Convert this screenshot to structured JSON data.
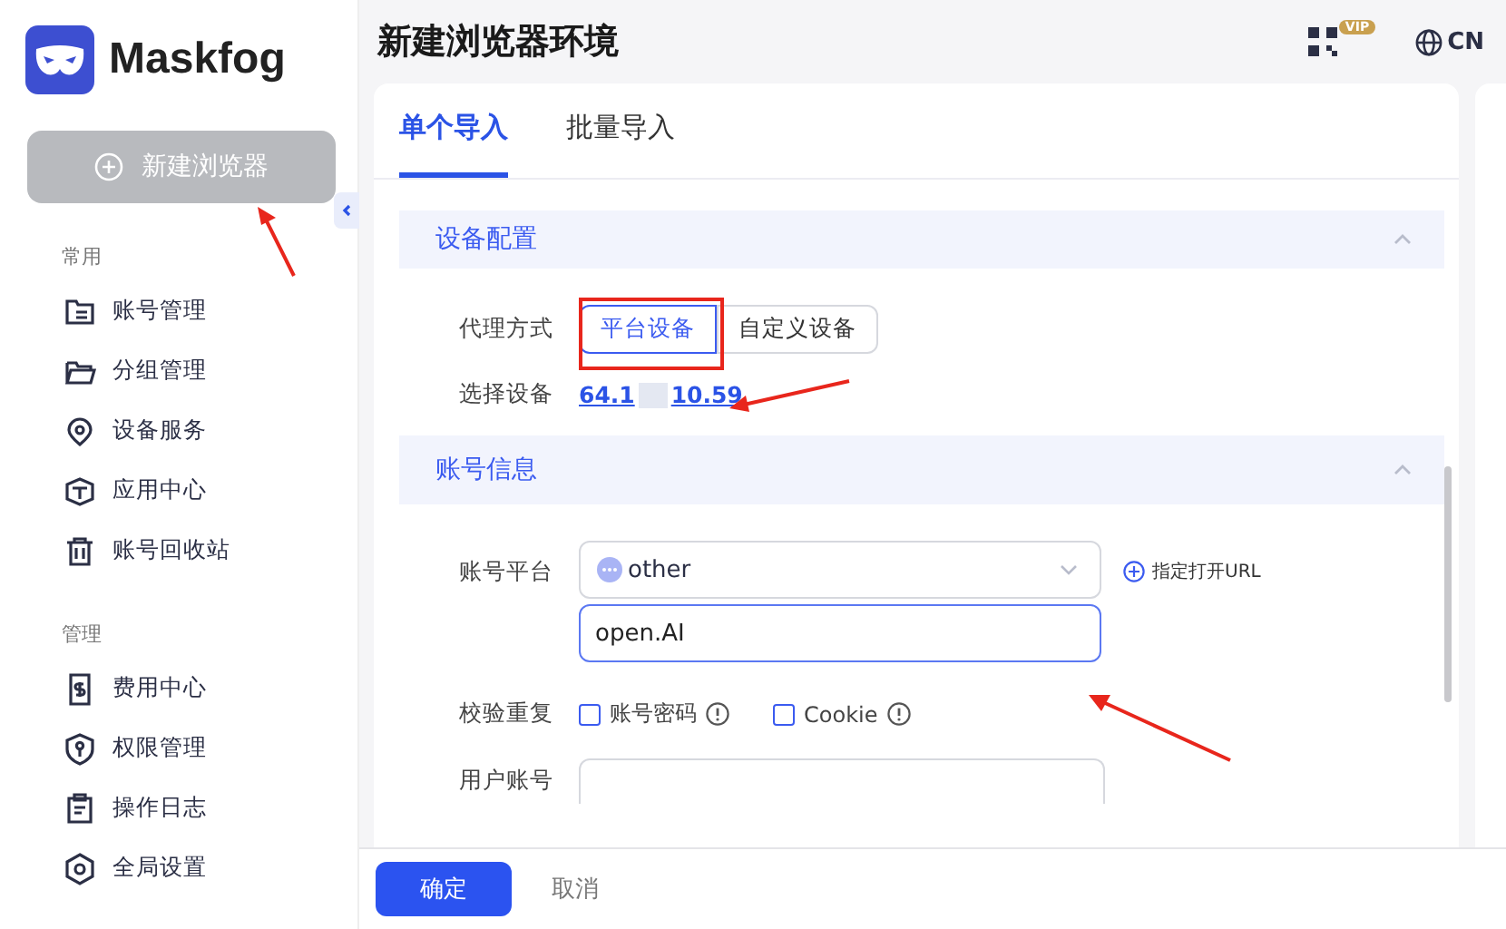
{
  "brand": {
    "name": "Maskfog"
  },
  "new_browser_button": {
    "label": "新建浏览器",
    "disabled": true
  },
  "sidebar": {
    "sections": [
      {
        "title": "常用",
        "items": [
          {
            "label": "账号管理",
            "kind": "list"
          },
          {
            "label": "分组管理",
            "kind": "folder"
          },
          {
            "label": "设备服务",
            "kind": "pin"
          },
          {
            "label": "应用中心",
            "kind": "box"
          },
          {
            "label": "账号回收站",
            "kind": "trash"
          }
        ]
      },
      {
        "title": "管理",
        "items": [
          {
            "label": "费用中心",
            "kind": "bill"
          },
          {
            "label": "权限管理",
            "kind": "shield"
          },
          {
            "label": "操作日志",
            "kind": "clipboard"
          },
          {
            "label": "全局设置",
            "kind": "hex"
          }
        ]
      }
    ]
  },
  "header": {
    "title": "新建浏览器环境",
    "badge": "VIP",
    "language": "CN"
  },
  "tabs": [
    {
      "label": "单个导入",
      "selected": true
    },
    {
      "label": "批量导入",
      "selected": false
    }
  ],
  "device_section": {
    "title": "设备配置",
    "expanded": true,
    "proxy_label": "代理方式",
    "proxy_options": [
      {
        "label": "平台设备",
        "selected": true
      },
      {
        "label": "自定义设备",
        "selected": false
      }
    ],
    "device_label": "选择设备",
    "device_prefix": "64.1",
    "device_suffix": "10.59",
    "redacted": true
  },
  "account_section": {
    "title": "账号信息",
    "expanded": true,
    "platform_label": "账号平台",
    "platform_value": "other",
    "url_link": "指定打开URL",
    "platform_name_value": "open.AI",
    "dedupe_label": "校验重复",
    "checks": [
      {
        "label": "账号密码",
        "checked": false
      },
      {
        "label": "Cookie",
        "checked": false
      }
    ],
    "user_label": "用户账号"
  },
  "footer": {
    "buttons": [
      {
        "label": "确定",
        "kind": "primary"
      },
      {
        "label": "取消",
        "kind": "text"
      }
    ]
  }
}
